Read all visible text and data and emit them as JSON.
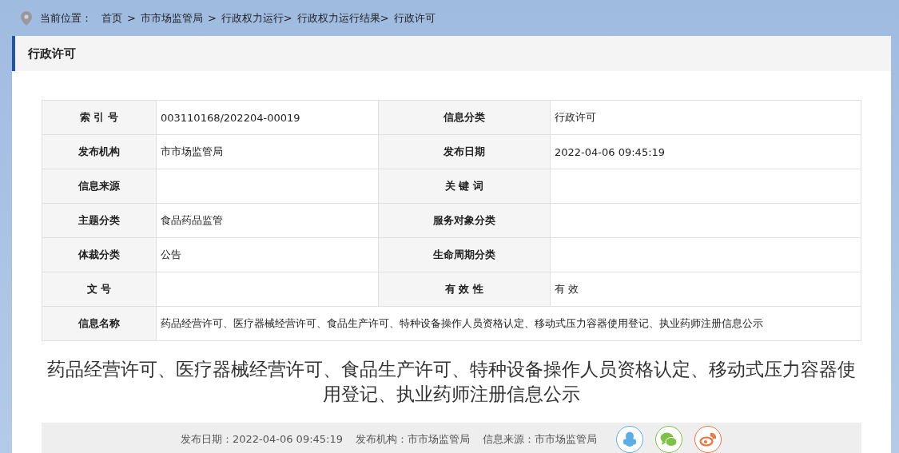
{
  "breadcrumb": {
    "label": "当前位置：",
    "items": [
      {
        "text": "首页",
        "separator": ">"
      },
      {
        "text": "市市场监管局",
        "separator": ">"
      },
      {
        "text": "行政权力运行>"
      },
      {
        "text": "行政权力运行结果>"
      },
      {
        "text": "行政许可"
      }
    ]
  },
  "section_title": "行政许可",
  "info_table": {
    "rows": [
      {
        "cells": [
          {
            "label": "索 引 号",
            "value": "003110168/202204-00019"
          },
          {
            "label": "信息分类",
            "value": "行政许可"
          }
        ]
      },
      {
        "cells": [
          {
            "label": "发布机构",
            "value": "市市场监管局"
          },
          {
            "label": "发布日期",
            "value": "2022-04-06 09:45:19"
          }
        ]
      },
      {
        "cells": [
          {
            "label": "信息来源"
          },
          {
            "label": "关 键 词"
          }
        ]
      },
      {
        "cells": [
          {
            "label": "主题分类",
            "value": "食品药品监管"
          },
          {
            "label": "服务对象分类"
          }
        ]
      },
      {
        "cells": [
          {
            "label": "体裁分类",
            "value": "公告"
          },
          {
            "label": "生命周期分类"
          }
        ]
      },
      {
        "cells": [
          {
            "label": "文 号"
          },
          {
            "label": "有 效 性",
            "value": "有 效"
          }
        ]
      },
      {
        "cells": [
          {
            "label": "信息名称",
            "value": "药品经营许可、医疗器械经营许可、食品生产许可、特种设备操作人员资格认定、移动式压力容器使用登记、执业药师注册信息公示"
          }
        ]
      }
    ]
  },
  "article_title": "药品经营许可、医疗器械经营许可、食品生产许可、特种设备操作人员资格认定、移动式压力容器使用登记、执业药师注册信息公示",
  "meta_bar": {
    "items": [
      "发布日期：2022-04-06 09:45:19",
      "发布机构：市市场监管局",
      "信息来源：市市场监管局"
    ],
    "share_buttons": [
      {
        "kind": "penguin",
        "color": "#5aaee6"
      },
      {
        "kind": "chat",
        "color": "#7dc244"
      },
      {
        "kind": "swirl",
        "color": "#f0703a"
      }
    ]
  }
}
